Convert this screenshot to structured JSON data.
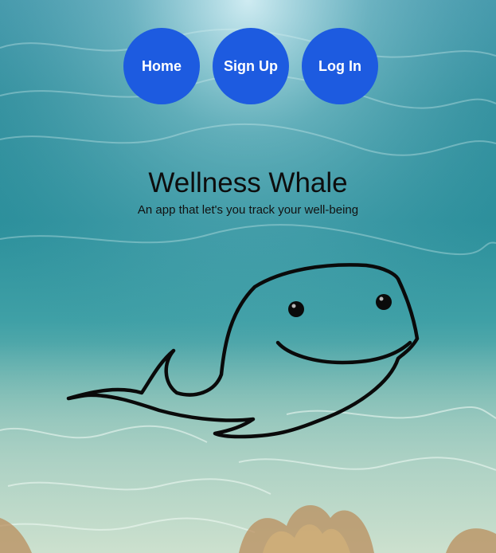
{
  "nav": {
    "home_label": "Home",
    "signup_label": "Sign Up",
    "login_label": "Log In"
  },
  "hero": {
    "title": "Wellness Whale",
    "subtitle": "An app that let's you track your well-being"
  },
  "illustration": {
    "icon": "whale-drawing-icon"
  },
  "colors": {
    "button": "#1d5be0",
    "button_text": "#ffffff",
    "water_top": "#3f95a8",
    "water_bottom": "#b4d3c4"
  }
}
